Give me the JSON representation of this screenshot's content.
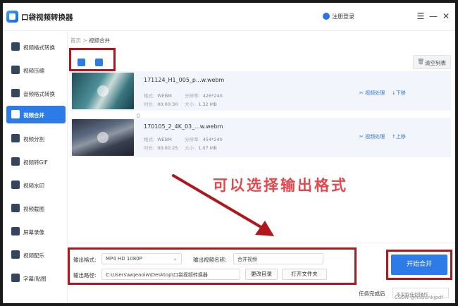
{
  "app": {
    "title": "口袋视频转换器",
    "login": "注册登录"
  },
  "sidebar": {
    "items": [
      {
        "label": "视频格式转换"
      },
      {
        "label": "视频压缩"
      },
      {
        "label": "音频格式转换"
      },
      {
        "label": "视频合并",
        "active": true
      },
      {
        "label": "视频分割"
      },
      {
        "label": "视频转GIF"
      },
      {
        "label": "视频水印"
      },
      {
        "label": "视频截图"
      },
      {
        "label": "屏幕录像"
      },
      {
        "label": "视频配乐"
      },
      {
        "label": "字幕/贴图"
      }
    ]
  },
  "breadcrumb": {
    "home": "首页",
    "sep": ">",
    "current": "视频合并"
  },
  "toolbar": {
    "clear_label": "清空列表"
  },
  "files": [
    {
      "name": "171124_H1_005_p...w.webm",
      "format_key": "格式:",
      "format": "WEBM",
      "res_key": "分辨率:",
      "res": "426*240",
      "time_key": "时长:",
      "time": "00:00:30",
      "size_key": "大小:",
      "size": "1.32 MB",
      "process": "视频处理",
      "move": "下移",
      "move_icon": "↓"
    },
    {
      "name": "170105_2_4K_03_...w.webm",
      "format_key": "格式:",
      "format": "WEBM",
      "res_key": "分辨率:",
      "res": "454*240",
      "time_key": "时长:",
      "time": "00:00:25",
      "size_key": "大小:",
      "size": "1.07 MB",
      "process": "视频处理",
      "move": "上移",
      "move_icon": "↑"
    }
  ],
  "annotation": "可以选择输出格式",
  "output": {
    "format_label": "输出格式:",
    "format_value": "MP4  HD 1080P",
    "name_label": "输出视频名称:",
    "name_value": "合并视频",
    "path_label": "输出路径:",
    "path_value": "C:\\Users\\wqeaoiw\\Desktop\\口袋视频转换器",
    "change_dir": "更改目录",
    "open_folder": "打开文件夹"
  },
  "start_label": "开始合并",
  "after": {
    "label": "任务完成后",
    "value": "不采取任何操作"
  },
  "watermark": "CSDN @hudunkjpdf",
  "colors": {
    "accent": "#2d7be6",
    "highlight": "#b0161d",
    "annotation": "#e8454c"
  }
}
